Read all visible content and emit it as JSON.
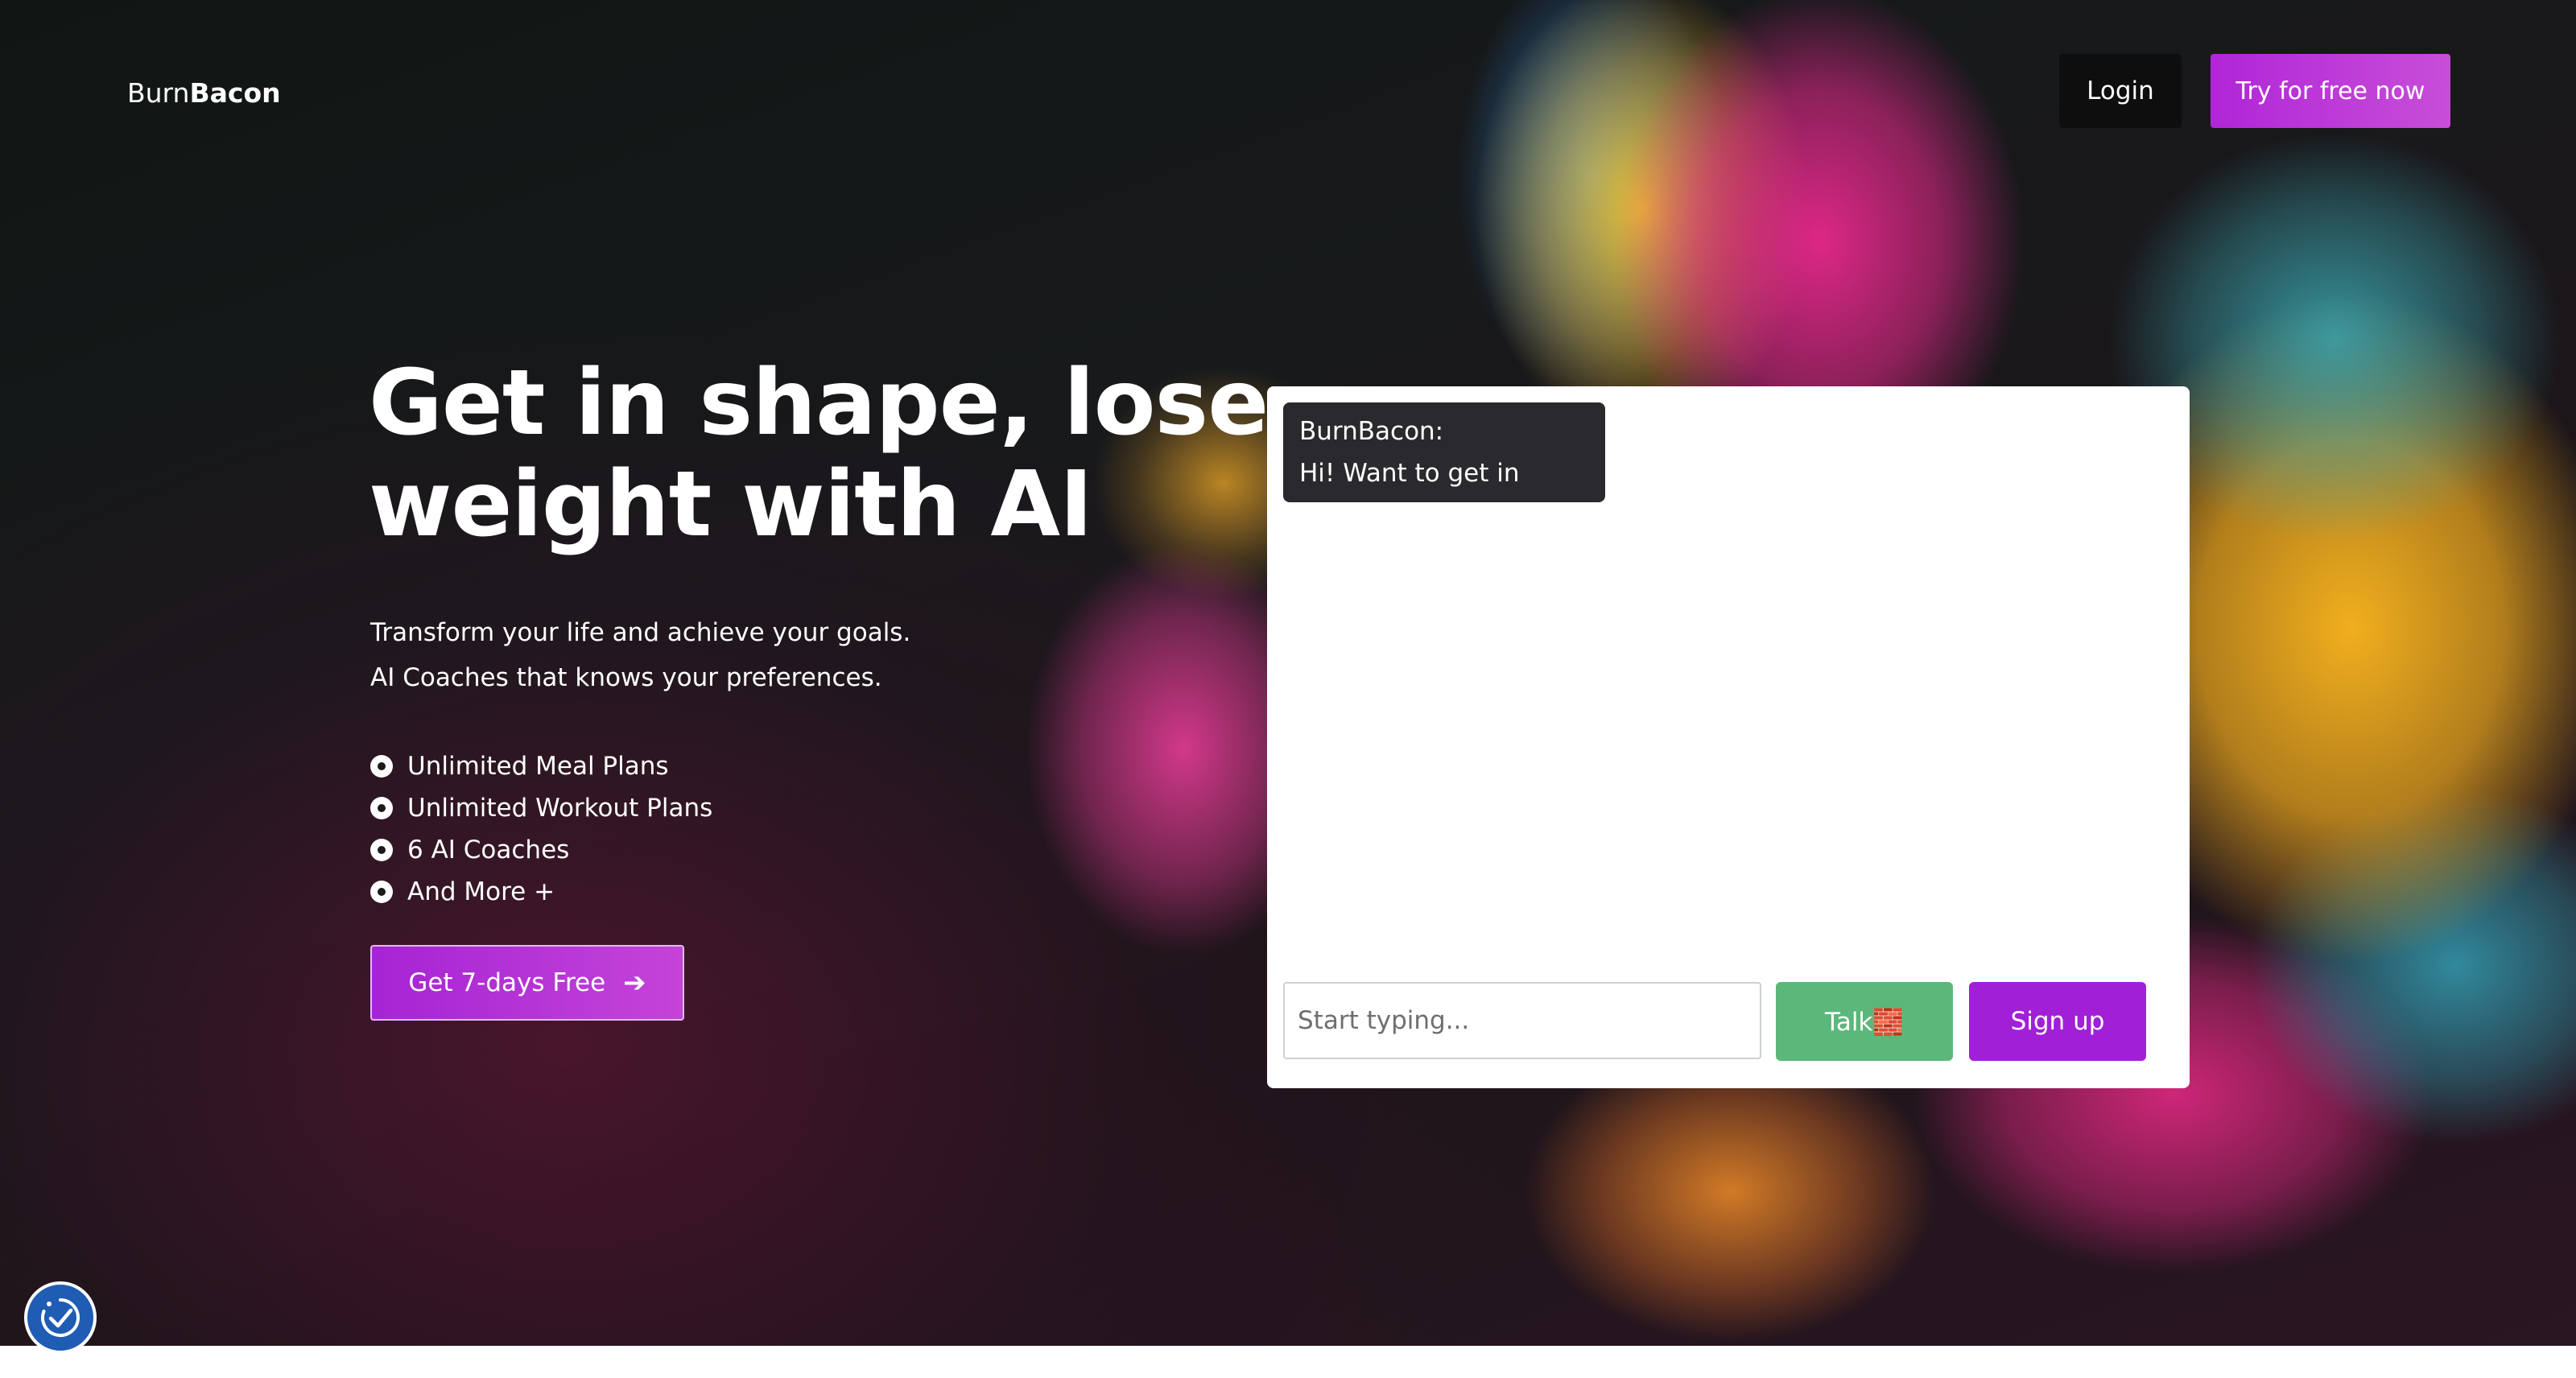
{
  "brand": {
    "prefix": "Burn",
    "suffix": "Bacon"
  },
  "nav": {
    "login_label": "Login",
    "try_label": "Try for free now"
  },
  "hero": {
    "headline": "Get in shape, lose weight with AI",
    "sub_lines": [
      "Transform your life and achieve your goals.",
      "AI Coaches that knows your preferences."
    ],
    "features": [
      "Unlimited Meal Plans",
      "Unlimited Workout Plans",
      "6 AI Coaches",
      "And More +"
    ],
    "cta_label": "Get 7-days Free"
  },
  "chat": {
    "messages": [
      {
        "sender": "BurnBacon:",
        "text": "Hi! Want to get in shape?"
      }
    ],
    "input_placeholder": "Start typing...",
    "talk_label": "Talk🧱",
    "signup_label": "Sign up"
  },
  "icons": {
    "cta_arrow": "arrow-right-icon",
    "feature_bullet": "radio-bullet-icon",
    "accessibility": "accessibility-check-icon"
  },
  "colors": {
    "accent_purple": "#a21fd8",
    "talk_green": "#5cb77a",
    "accessibility_blue": "#1f5cb3"
  }
}
